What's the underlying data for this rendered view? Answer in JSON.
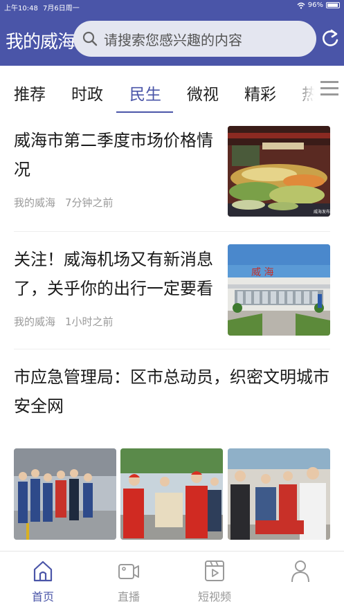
{
  "status_bar": {
    "time": "上午10:48",
    "date": "7月6日周一",
    "battery": "96%"
  },
  "header": {
    "logo_text": "我的威海",
    "search_placeholder": "请搜索您感兴趣的内容",
    "icons": [
      "search-icon",
      "refresh-icon"
    ]
  },
  "tabs": [
    {
      "label": "推荐",
      "active": false
    },
    {
      "label": "时政",
      "active": false
    },
    {
      "label": "民生",
      "active": true
    },
    {
      "label": "微视",
      "active": false
    },
    {
      "label": "精彩",
      "active": false
    },
    {
      "label": "热",
      "active": false
    }
  ],
  "articles": [
    {
      "title_line1": "威海市第二季度市场价格情",
      "title_line2": "况",
      "source": "我的威海",
      "time": "7分钟之前",
      "thumb_caption": "威海发布"
    },
    {
      "title_line1": "关注！威海机场又有新消息",
      "title_line2": "了，关乎你的出行一定要看",
      "source": "我的威海",
      "time": "1小时之前",
      "thumb_sign": "威   海"
    },
    {
      "title_line1": "市应急管理局：区市总动员，织密文明城市",
      "title_line2": "安全网"
    }
  ],
  "bottom_nav": [
    {
      "label": "首页",
      "icon": "home-icon",
      "active": true
    },
    {
      "label": "直播",
      "icon": "video-camera-icon",
      "active": false
    },
    {
      "label": "短视频",
      "icon": "film-icon",
      "active": false
    },
    {
      "label": "",
      "icon": "user-icon",
      "active": false
    }
  ],
  "colors": {
    "brand": "#4a55a8",
    "muted_text": "#9a9a9a",
    "search_bg": "#e4e6f0"
  }
}
